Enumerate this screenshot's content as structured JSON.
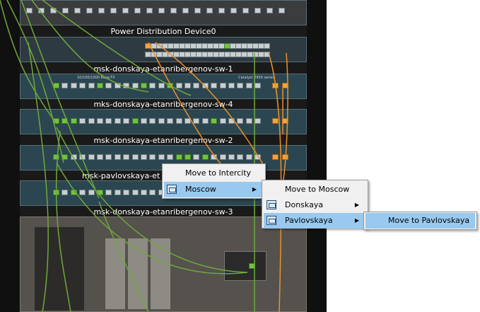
{
  "rack": {
    "devices": [
      {
        "label": "Power Distribution Device0"
      },
      {
        "label": "msk-donskaya-etanribergenov-sw-1"
      },
      {
        "label": "mks-donskaya-etanribergenov-sw-4"
      },
      {
        "label": "msk-donskaya-etanribergenov-sw-2"
      },
      {
        "label": "msk-pavlovskaya-et"
      },
      {
        "label": "msk-donskaya-etanribergenov-sw-3"
      }
    ],
    "switch_model": "Catalyst 2950 series",
    "switch_ports_caption": "10/100/1000 Base-TX"
  },
  "colors": {
    "cable_green": "#6fa83a",
    "cable_orange": "#e9912c",
    "menu_highlight": "#99c9ef",
    "menu_bg": "#f0f0f0"
  },
  "context_menu": {
    "level1": [
      {
        "label": "Move to Intercity",
        "icon": null,
        "submenu": false
      },
      {
        "label": "Moscow",
        "icon": "building-icon",
        "submenu": true,
        "highlighted": true
      }
    ],
    "level2": [
      {
        "label": "Move to Moscow",
        "icon": null,
        "submenu": false
      },
      {
        "label": "Donskaya",
        "icon": "building-icon",
        "submenu": true
      },
      {
        "label": "Pavlovskaya",
        "icon": "building-icon",
        "submenu": true,
        "highlighted": true
      }
    ],
    "level3": [
      {
        "label": "Move to Pavlovskaya",
        "icon": null,
        "submenu": false,
        "highlighted": true
      }
    ],
    "arrow_glyph": "▶"
  }
}
